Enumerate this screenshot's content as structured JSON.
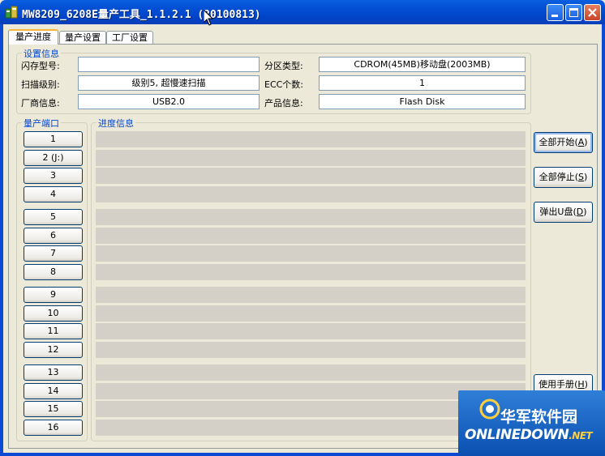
{
  "window": {
    "title": "MW8209_6208E量产工具_1.1.2.1 (20100813)"
  },
  "tabs": [
    {
      "label": "量产进度",
      "active": true
    },
    {
      "label": "量产设置",
      "active": false
    },
    {
      "label": "工厂设置",
      "active": false
    }
  ],
  "settings": {
    "title": "设置信息",
    "flash_model": {
      "label": "闪存型号:",
      "value": ""
    },
    "scan_level": {
      "label": "扫描级别:",
      "value": "级别5, 超慢速扫描"
    },
    "vendor_info": {
      "label": "厂商信息:",
      "value": "USB2.0"
    },
    "partition_type": {
      "label": "分区类型:",
      "value": "CDROM(45MB)移动盘(2003MB)"
    },
    "ecc_count": {
      "label": "ECC个数:",
      "value": "1"
    },
    "product_info": {
      "label": "产品信息:",
      "value": "Flash Disk"
    }
  },
  "ports": {
    "title": "量产端口",
    "items": [
      "1",
      "2 (J:)",
      "3",
      "4",
      "5",
      "6",
      "7",
      "8",
      "9",
      "10",
      "11",
      "12",
      "13",
      "14",
      "15",
      "16"
    ]
  },
  "progress": {
    "title": "进度信息"
  },
  "buttons": {
    "start_all": {
      "label": "全部开始",
      "key": "A"
    },
    "stop_all": {
      "label": "全部停止",
      "key": "S"
    },
    "eject": {
      "label": "弹出U盘",
      "key": "D"
    },
    "manual": {
      "label": "使用手册",
      "key": "H"
    }
  },
  "watermark": {
    "cn": "华军软件园",
    "en": "ONLINEDOWN",
    "suffix": ".NET"
  },
  "colors": {
    "titlebar": "#0351d6",
    "group_title": "#0046d5",
    "progress_bar": "#d4d0c8"
  }
}
